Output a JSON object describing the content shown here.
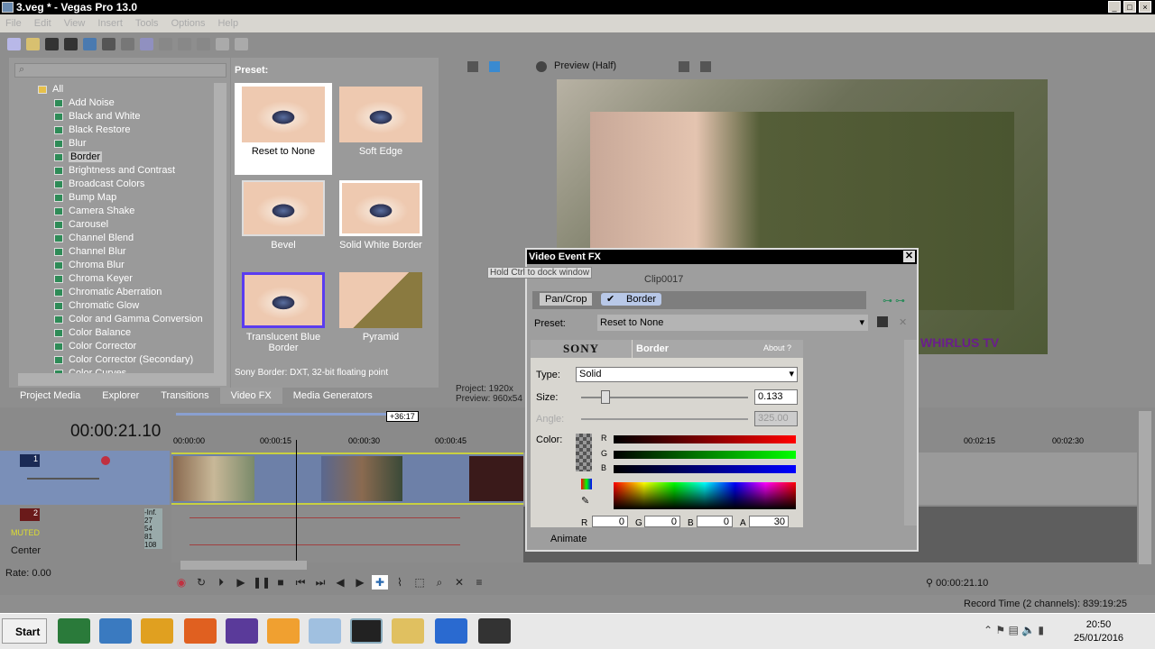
{
  "app": {
    "title": "3.veg * - Vegas Pro 13.0"
  },
  "menu": [
    "File",
    "Edit",
    "View",
    "Insert",
    "Tools",
    "Options",
    "Help"
  ],
  "fx_tree": {
    "root": "All",
    "items": [
      "Add Noise",
      "Black and White",
      "Black Restore",
      "Blur",
      "Border",
      "Brightness and Contrast",
      "Broadcast Colors",
      "Bump Map",
      "Camera Shake",
      "Carousel",
      "Channel Blend",
      "Channel Blur",
      "Chroma Blur",
      "Chroma Keyer",
      "Chromatic Aberration",
      "Chromatic Glow",
      "Color and Gamma Conversion",
      "Color Balance",
      "Color Corrector",
      "Color Corrector (Secondary)",
      "Color Curves"
    ],
    "selected": "Border"
  },
  "presets": {
    "label": "Preset:",
    "items": [
      "Reset to None",
      "Soft Edge",
      "Bevel",
      "Solid White Border",
      "Translucent Blue Border",
      "Pyramid"
    ],
    "selected": "Reset to None",
    "description": "Sony Border: DXT, 32-bit floating point"
  },
  "tabs": [
    "Project Media",
    "Explorer",
    "Transitions",
    "Video FX",
    "Media Generators"
  ],
  "active_tab": "Video FX",
  "preview": {
    "mode": "Preview (Half)",
    "watermark": "WHIRLUS TV",
    "project_label": "Project: 1920x",
    "preview_label": "Preview: 960x54"
  },
  "dialog": {
    "title": "Video Event FX",
    "hint": "Hold Ctrl to dock window",
    "clip": "Clip0017",
    "chain": [
      "Pan/Crop",
      "Border"
    ],
    "preset_label": "Preset:",
    "preset_value": "Reset to None",
    "plugin_brand": "SONY",
    "plugin_name": "Border",
    "about": "About",
    "help": "?",
    "type_label": "Type:",
    "type_value": "Solid",
    "size_label": "Size:",
    "size_value": "0.133",
    "size_fraction": 0.13,
    "angle_label": "Angle:",
    "angle_value": "325.00",
    "color_label": "Color:",
    "r_label": "R",
    "g_label": "G",
    "b_label": "B",
    "a_label": "A",
    "r": "0",
    "g": "0",
    "b": "0",
    "a": "30",
    "animate": "Animate"
  },
  "timeline": {
    "timecode": "00:00:21.10",
    "offset": "+36:17",
    "ruler": [
      "00:00:00",
      "00:00:15",
      "00:00:30",
      "00:00:45",
      "00:02:15",
      "00:02:30"
    ],
    "track1_num": "1",
    "track2_num": "2",
    "muted": "MUTED",
    "pan": "Center",
    "meter": [
      "-Inf.",
      "27",
      "54",
      "81",
      "108"
    ],
    "rate": "Rate: 0.00",
    "cursor_time": "00:00:21.10"
  },
  "status": {
    "record_time": "Record Time (2 channels): 839:19:25"
  },
  "taskbar": {
    "start": "Start",
    "time": "20:50",
    "date": "25/01/2016"
  }
}
